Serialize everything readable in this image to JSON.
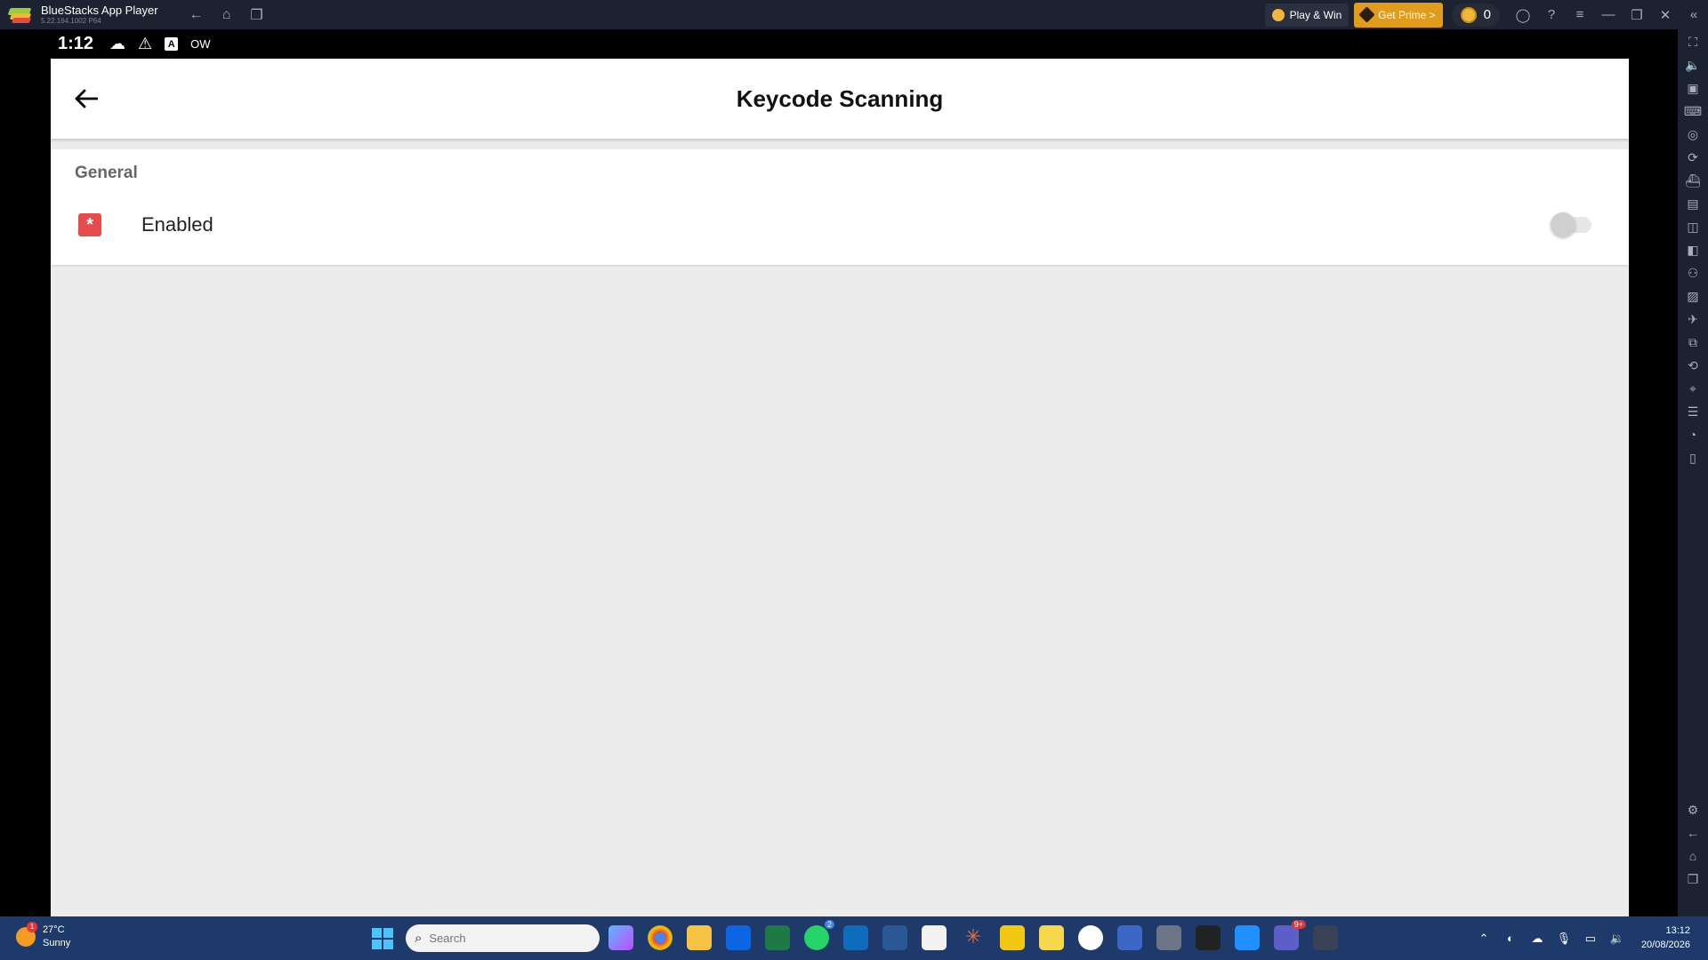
{
  "window": {
    "title": "BlueStacks App Player",
    "version": "5.22.164.1002 P64",
    "play_win": "Play & Win",
    "get_prime": "Get Prime >",
    "coins": "0"
  },
  "status_bar": {
    "time": "1:12",
    "ow_label": "OW"
  },
  "app": {
    "title": "Keycode Scanning",
    "section": "General",
    "row_label": "Enabled",
    "toggle_on": false,
    "colors": {
      "row_icon": "#e74c4c",
      "accent": "#e09c1a"
    }
  },
  "taskbar": {
    "weather_temp": "27°C",
    "weather_desc": "Sunny",
    "weather_badge": "1",
    "search_placeholder": "Search",
    "whatsapp_badge": "2",
    "teams_badge": "9+",
    "time": "13:12",
    "date": "20/08/2026"
  }
}
